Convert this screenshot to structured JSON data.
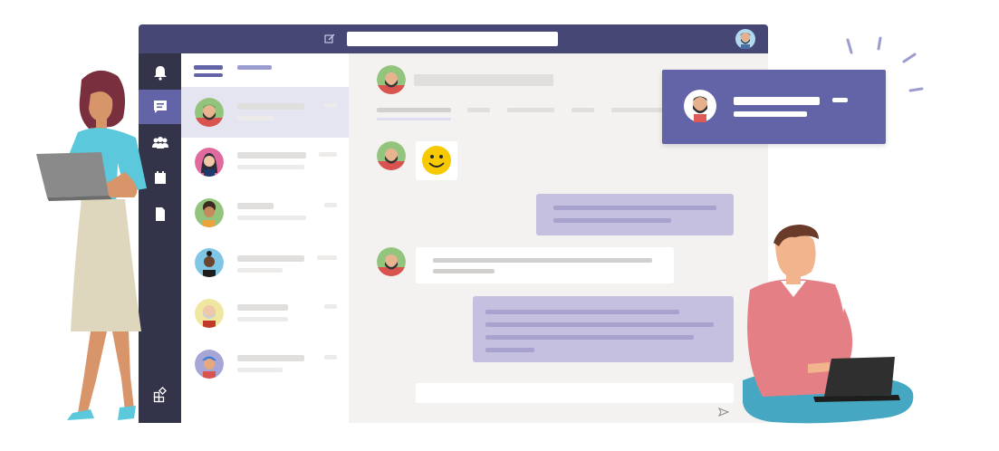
{
  "app": {
    "accent": "#6264a7",
    "titlebar_color": "#464775",
    "rail_color": "#33344a",
    "chat_bg": "#f3f2f1",
    "search": {
      "value": ""
    }
  },
  "rail": {
    "items": [
      {
        "icon": "bell-icon"
      },
      {
        "icon": "chat-icon",
        "active": true
      },
      {
        "icon": "teams-icon"
      },
      {
        "icon": "calendar-icon"
      },
      {
        "icon": "files-icon"
      }
    ],
    "bottom_icon": "apps-icon"
  },
  "chat_list": {
    "tabs": [
      {
        "icon": "tab-chat"
      },
      {
        "icon": "tab-contacts"
      }
    ],
    "rows": [
      {
        "avatar": "bearded-man-green-bg",
        "active": true
      },
      {
        "avatar": "woman-pink-bg"
      },
      {
        "avatar": "curly-man-green-bg"
      },
      {
        "avatar": "woman-blue-bg"
      },
      {
        "avatar": "old-man-yellow-bg"
      },
      {
        "avatar": "man-cap-purple-bg"
      }
    ]
  },
  "conversation": {
    "messages": [
      {
        "from": "bearded-man",
        "type": "emoji",
        "content": "smiley-emoji-icon"
      },
      {
        "from": "me",
        "type": "text"
      },
      {
        "from": "bearded-man",
        "type": "text"
      },
      {
        "from": "me",
        "type": "text"
      }
    ],
    "compose": {
      "placeholder": "",
      "send_icon": "send-icon"
    }
  },
  "notification": {
    "avatar": "bearded-man-toast"
  }
}
